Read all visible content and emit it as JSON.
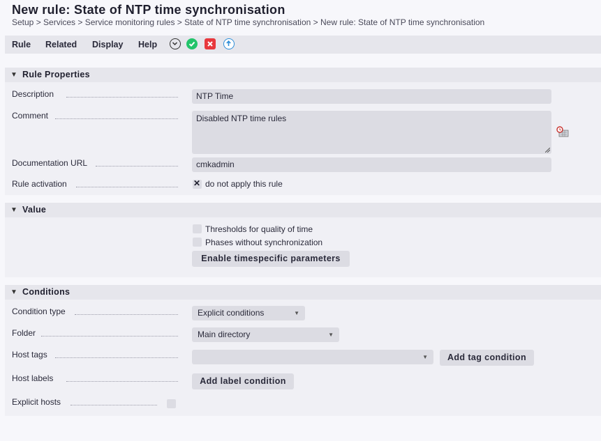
{
  "page": {
    "title": "New rule: State of NTP time synchronisation",
    "breadcrumb": "Setup > Services > Service monitoring rules > State of NTP time synchronisation > New rule: State of NTP time synchronisation"
  },
  "menu": {
    "rule": "Rule",
    "related": "Related",
    "display": "Display",
    "help": "Help",
    "icons": [
      "chevron-down-icon",
      "save-check-icon",
      "cancel-x-icon",
      "upload-arrow-icon"
    ]
  },
  "colors": {
    "accent_green": "#23c46b",
    "cancel_red": "#e8383d",
    "info_blue": "#2e8ed8",
    "background": "#f7f7fb",
    "section_header": "#e6e6ec"
  },
  "rule_properties": {
    "header": "Rule Properties",
    "description_label": "Description",
    "description_value": "NTP Time",
    "comment_label": "Comment",
    "comment_value": "Disabled NTP time rules",
    "doc_url_label": "Documentation URL",
    "doc_url_value": "cmkadmin",
    "activation_label": "Rule activation",
    "activation_option": "do not apply this rule",
    "activation_checked": true
  },
  "value": {
    "header": "Value",
    "opt1": "Thresholds for quality of time",
    "opt2": "Phases without synchronization",
    "timespecific_button": "Enable timespecific parameters"
  },
  "conditions": {
    "header": "Conditions",
    "condition_type_label": "Condition type",
    "condition_type_value": "Explicit conditions",
    "folder_label": "Folder",
    "folder_value": "Main directory",
    "host_tags_label": "Host tags",
    "host_tags_value": "",
    "add_tag_button": "Add tag condition",
    "host_labels_label": "Host labels",
    "add_label_button": "Add label condition",
    "explicit_hosts_label": "Explicit hosts"
  }
}
